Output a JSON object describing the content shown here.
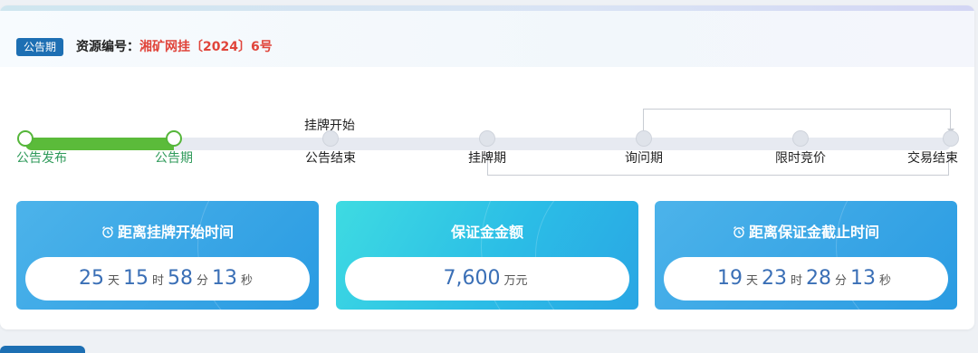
{
  "header": {
    "badge": "公告期",
    "resource_label": "资源编号：",
    "resource_value": "湘矿网挂〔2024〕6号"
  },
  "progress": {
    "above_label": "挂牌开始",
    "completed_fraction": 0.16,
    "steps": [
      {
        "label": "公告发布",
        "done": true
      },
      {
        "label": "公告期",
        "done": true
      },
      {
        "label": "公告结束",
        "done": false
      },
      {
        "label": "挂牌期",
        "done": false
      },
      {
        "label": "询问期",
        "done": false
      },
      {
        "label": "限时竞价",
        "done": false
      },
      {
        "label": "交易结束",
        "done": false
      }
    ]
  },
  "boxes": {
    "countdown_start": {
      "title": "距离挂牌开始时间",
      "icon": "alarm-clock-icon",
      "days": "25",
      "days_unit": "天",
      "hours": "15",
      "hours_unit": "时",
      "minutes": "58",
      "minutes_unit": "分",
      "seconds": "13",
      "seconds_unit": "秒"
    },
    "deposit": {
      "title": "保证金金额",
      "amount": "7,600",
      "unit": "万元"
    },
    "countdown_deposit": {
      "title": "距离保证金截止时间",
      "icon": "alarm-clock-icon",
      "days": "19",
      "days_unit": "天",
      "hours": "23",
      "hours_unit": "时",
      "minutes": "28",
      "minutes_unit": "分",
      "seconds": "13",
      "seconds_unit": "秒"
    }
  },
  "colors": {
    "accent": "#1d6fb3",
    "progress_done": "#5bbb3a",
    "resource_value": "#e0443a",
    "box_blue": "#2a9be2",
    "box_cyan": "#3edbe2"
  }
}
